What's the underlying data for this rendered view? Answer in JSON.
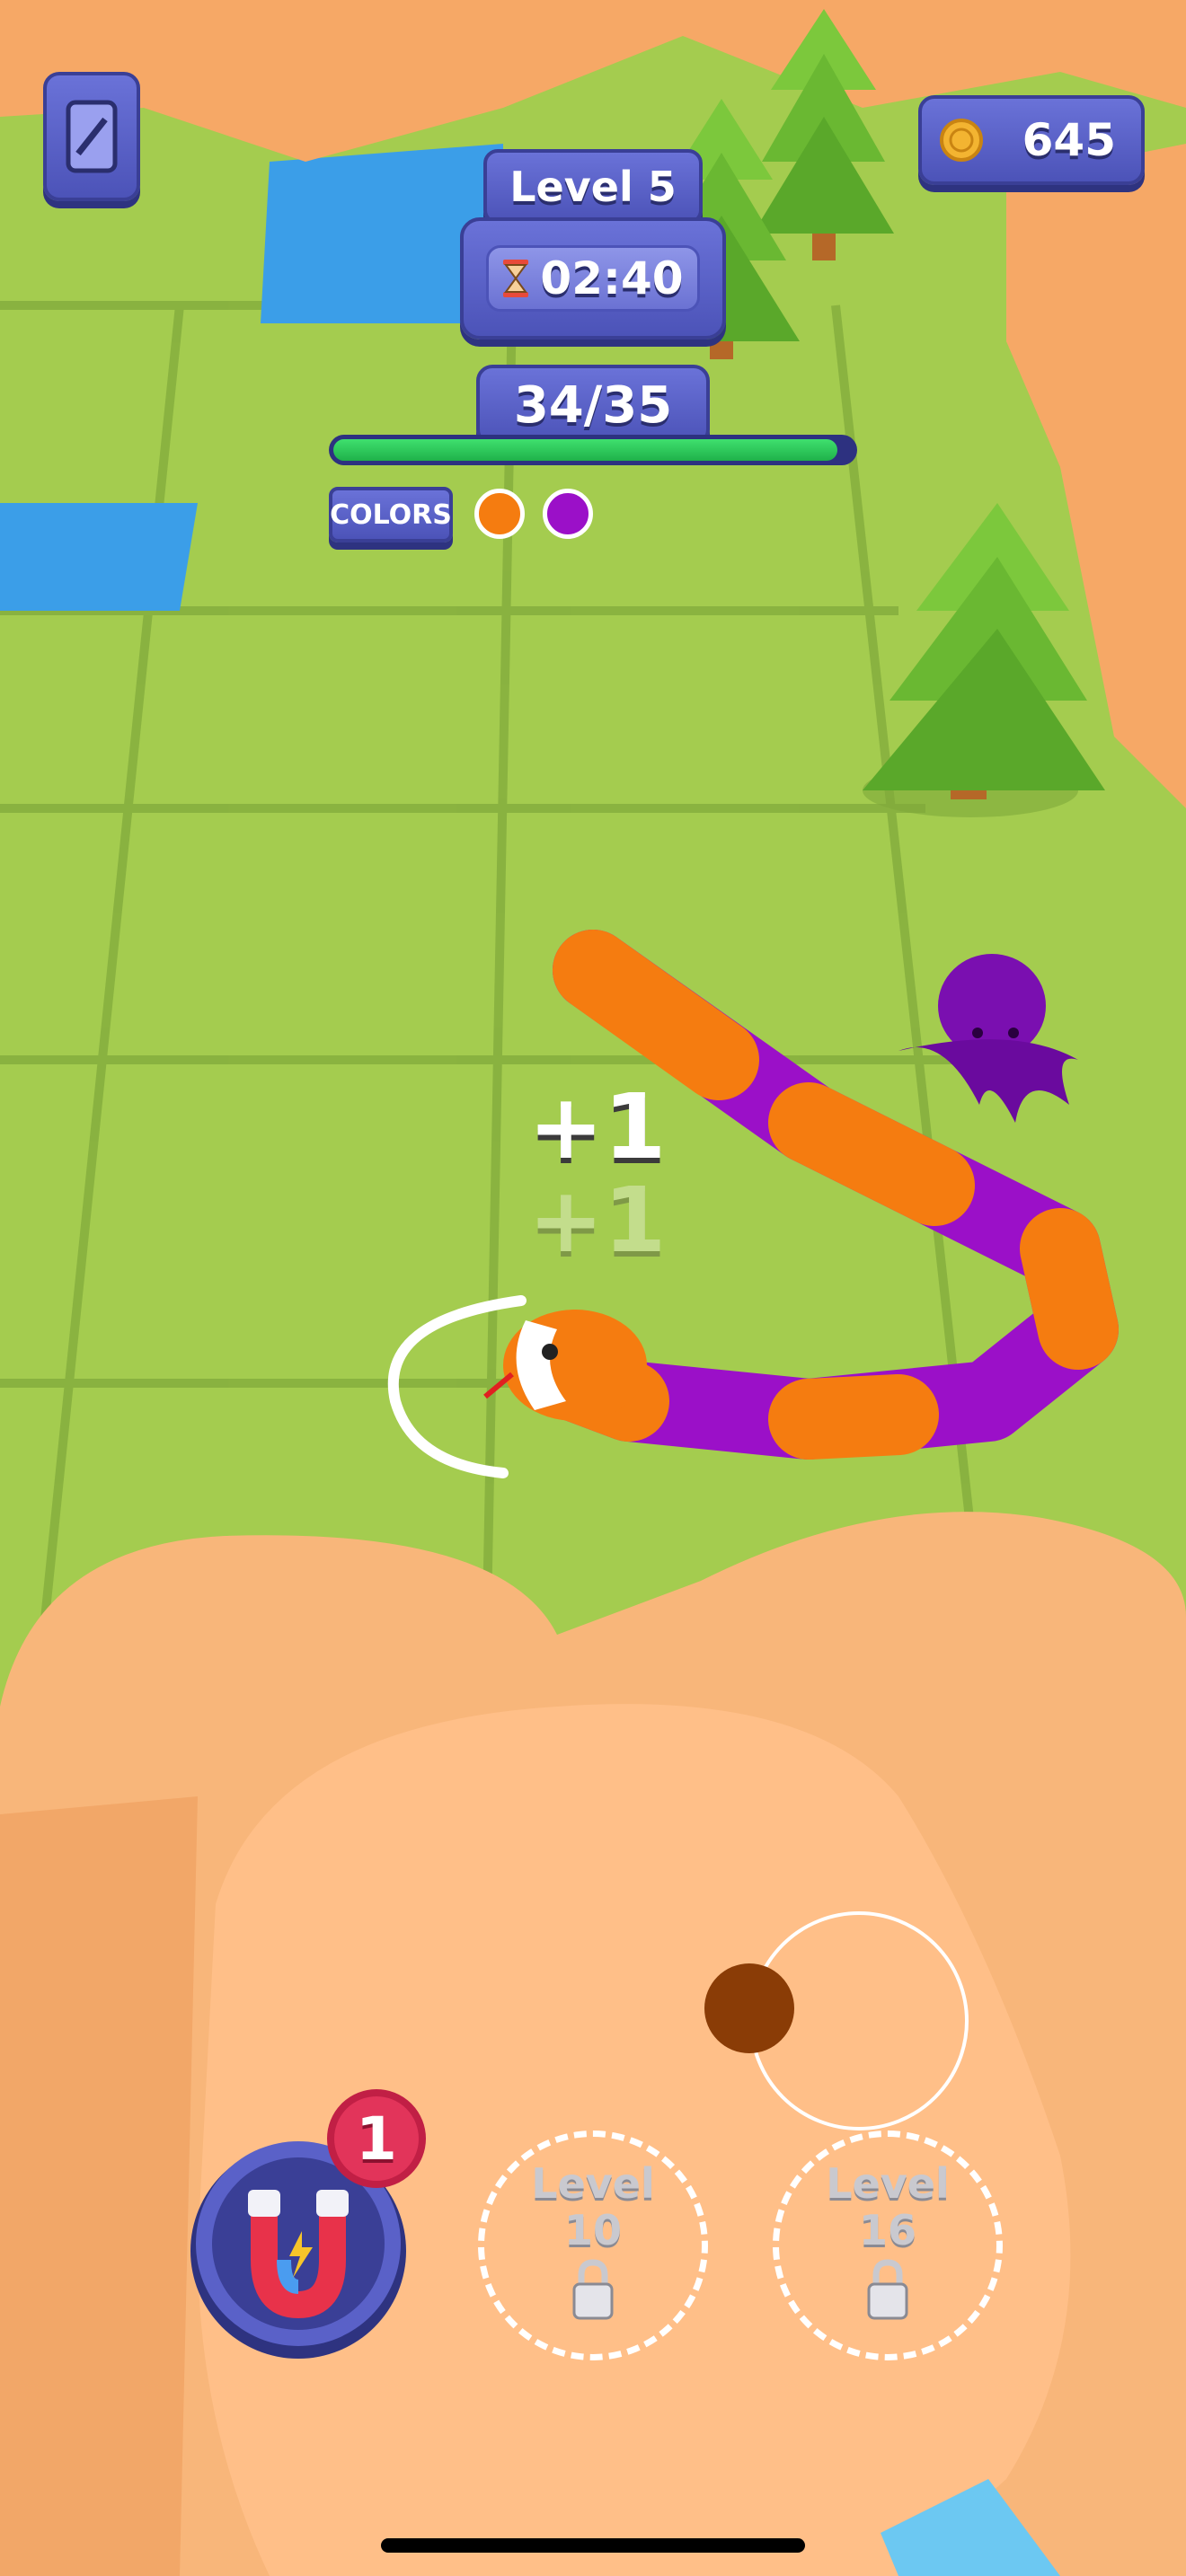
{
  "hud": {
    "level_label": "Level 5",
    "timer": "02:40",
    "progress_text": "34/35",
    "progress": {
      "current": 34,
      "total": 35
    },
    "colors_label": "COLORS",
    "color_swatches": [
      "#f57c10",
      "#9b10c8"
    ],
    "coin_count": "645"
  },
  "floating_text": {
    "score_popup": "+1",
    "score_popup_faded": "+1"
  },
  "powerups": {
    "magnet_count": "1",
    "locked": [
      {
        "line1": "Level",
        "line2": "10"
      },
      {
        "line1": "Level",
        "line2": "16"
      }
    ]
  },
  "icons": {
    "pause": "pause-card-icon",
    "coin": "coin-icon",
    "timer": "hourglass-icon",
    "magnet": "magnet-icon",
    "lock": "lock-icon"
  },
  "colors": {
    "panel": "#5a61c8",
    "progress_fill": "#2ecc5a",
    "grass": "#9cc74a",
    "rock": "#f8b67a",
    "water": "#3b9ee8",
    "snake_orange": "#f57c10",
    "snake_purple": "#9b10c8"
  }
}
